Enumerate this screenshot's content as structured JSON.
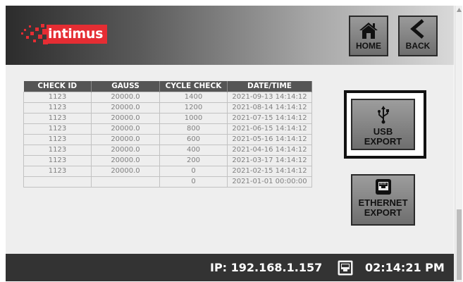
{
  "header": {
    "logo_text": "intimus",
    "home_label": "HOME",
    "back_label": "BACK",
    "home_icon": "house-icon",
    "back_icon": "chevron-left-icon"
  },
  "table": {
    "columns": [
      "CHECK ID",
      "GAUSS",
      "CYCLE CHECK",
      "DATE/TIME"
    ],
    "rows": [
      [
        "1123",
        "20000.0",
        "1400",
        "2021-09-13 14:14:12"
      ],
      [
        "1123",
        "20000.0",
        "1200",
        "2021-08-14 14:14:12"
      ],
      [
        "1123",
        "20000.0",
        "1000",
        "2021-07-15 14:14:12"
      ],
      [
        "1123",
        "20000.0",
        "800",
        "2021-06-15 14:14:12"
      ],
      [
        "1123",
        "20000.0",
        "600",
        "2021-05-16 14:14:12"
      ],
      [
        "1123",
        "20000.0",
        "400",
        "2021-04-16 14:14:12"
      ],
      [
        "1123",
        "20000.0",
        "200",
        "2021-03-17 14:14:12"
      ],
      [
        "1123",
        "20000.0",
        "0",
        "2021-02-15 14:14:12"
      ],
      [
        "",
        "",
        "0",
        "2021-01-01 00:00:00"
      ]
    ]
  },
  "export": {
    "usb_line1": "USB",
    "usb_line2": "EXPORT",
    "ethernet_line1": "ETHERNET",
    "ethernet_line2": "EXPORT",
    "usb_icon": "usb-icon",
    "ethernet_icon": "ethernet-port-icon"
  },
  "footer": {
    "ip": "IP: 192.168.1.157",
    "time": "02:14:21 PM"
  },
  "colors": {
    "brand_red": "#e52d33",
    "footer_bg": "#333333",
    "table_header_bg": "#555555"
  }
}
